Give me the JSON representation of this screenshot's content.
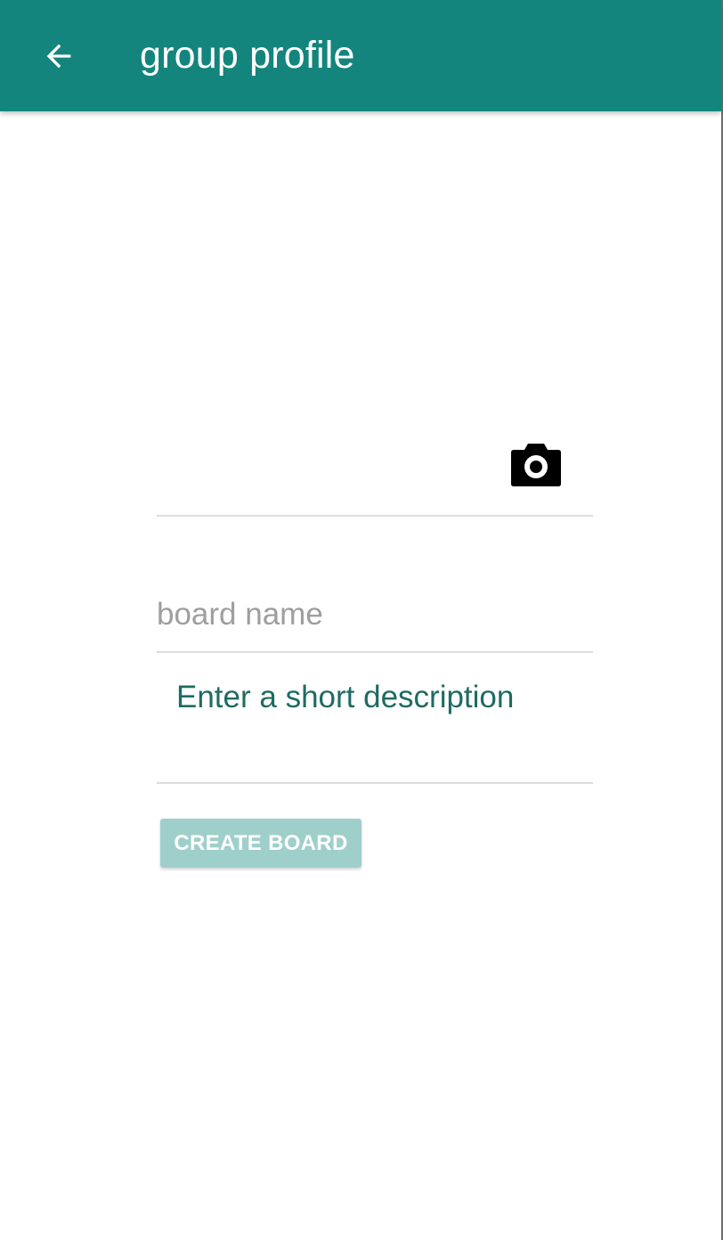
{
  "app_bar": {
    "title": "group profile",
    "back_icon": "arrow-left-icon",
    "background_color": "#13857d",
    "text_color": "#ffffff"
  },
  "photo": {
    "camera_icon": "camera-icon"
  },
  "form": {
    "board_name": {
      "value": "",
      "placeholder": "board name"
    },
    "description": {
      "value": "",
      "placeholder": "Enter a short description"
    },
    "create_button_label": "CREATE BOARD",
    "create_button_color": "#9fcfcb"
  }
}
